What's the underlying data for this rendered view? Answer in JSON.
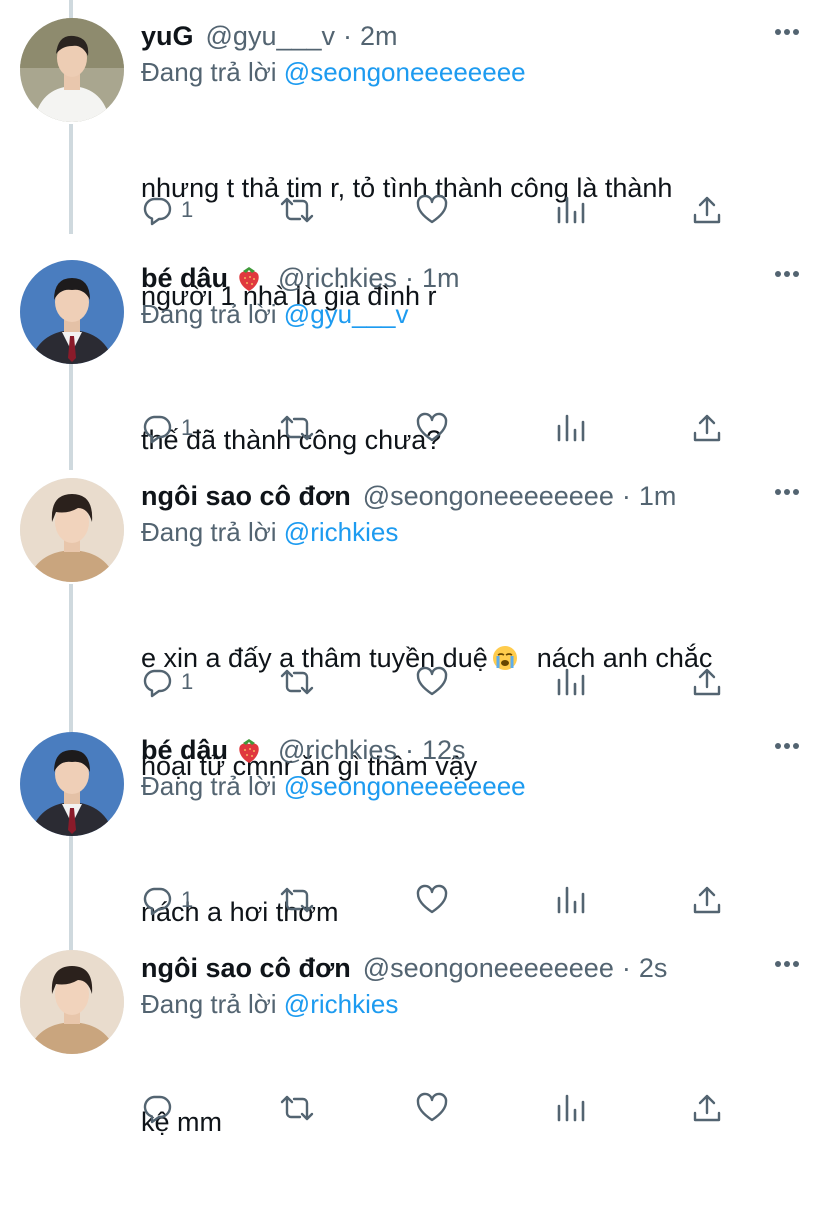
{
  "colors": {
    "text": "#0f1419",
    "secondary": "#536471",
    "link": "#1d9bf0",
    "thread_line": "#cfd9de"
  },
  "reply_prefix": "Đang trả lời",
  "tweets": [
    {
      "name": "yuG",
      "handle": "@gyu___v",
      "time": "2m",
      "reply_to": "@seongoneeeeeeee",
      "text_lines": [
        "nhưng t thả tim r, tỏ tình thành công là thành",
        "người 1 nhà là gia đình r"
      ],
      "reply_count": "1",
      "avatar_icon": "user-avatar-white-shirt",
      "name_emoji": ""
    },
    {
      "name": "bé dâu",
      "handle": "@richkies",
      "time": "1m",
      "reply_to": "@gyu___v",
      "text_lines": [
        "thế đã thành công chưa?"
      ],
      "reply_count": "1",
      "avatar_icon": "user-avatar-school-uniform",
      "name_emoji": "strawberry-icon"
    },
    {
      "name": "ngôi sao cô đơn",
      "handle": "@seongoneeeeeeee",
      "time": "1m",
      "reply_to": "@richkies",
      "text_lines": [
        "e xin a đấy a thâm tuyền duệ",
        "  nách anh chắc",
        "hoại tử cmnr ăn gì thâm vậy"
      ],
      "reply_count": "1",
      "avatar_icon": "user-avatar-beige",
      "name_emoji": "",
      "text_emoji": "loudly-crying-face-icon"
    },
    {
      "name": "bé dâu",
      "handle": "@richkies",
      "time": "12s",
      "reply_to": "@seongoneeeeeeee",
      "text_lines": [
        "nách a hơi thơm"
      ],
      "reply_count": "1",
      "avatar_icon": "user-avatar-school-uniform",
      "name_emoji": "strawberry-icon"
    },
    {
      "name": "ngôi sao cô đơn",
      "handle": "@seongoneeeeeeee",
      "time": "2s",
      "reply_to": "@richkies",
      "text_lines": [
        "kệ mm"
      ],
      "reply_count": "",
      "avatar_icon": "user-avatar-beige",
      "name_emoji": ""
    }
  ]
}
